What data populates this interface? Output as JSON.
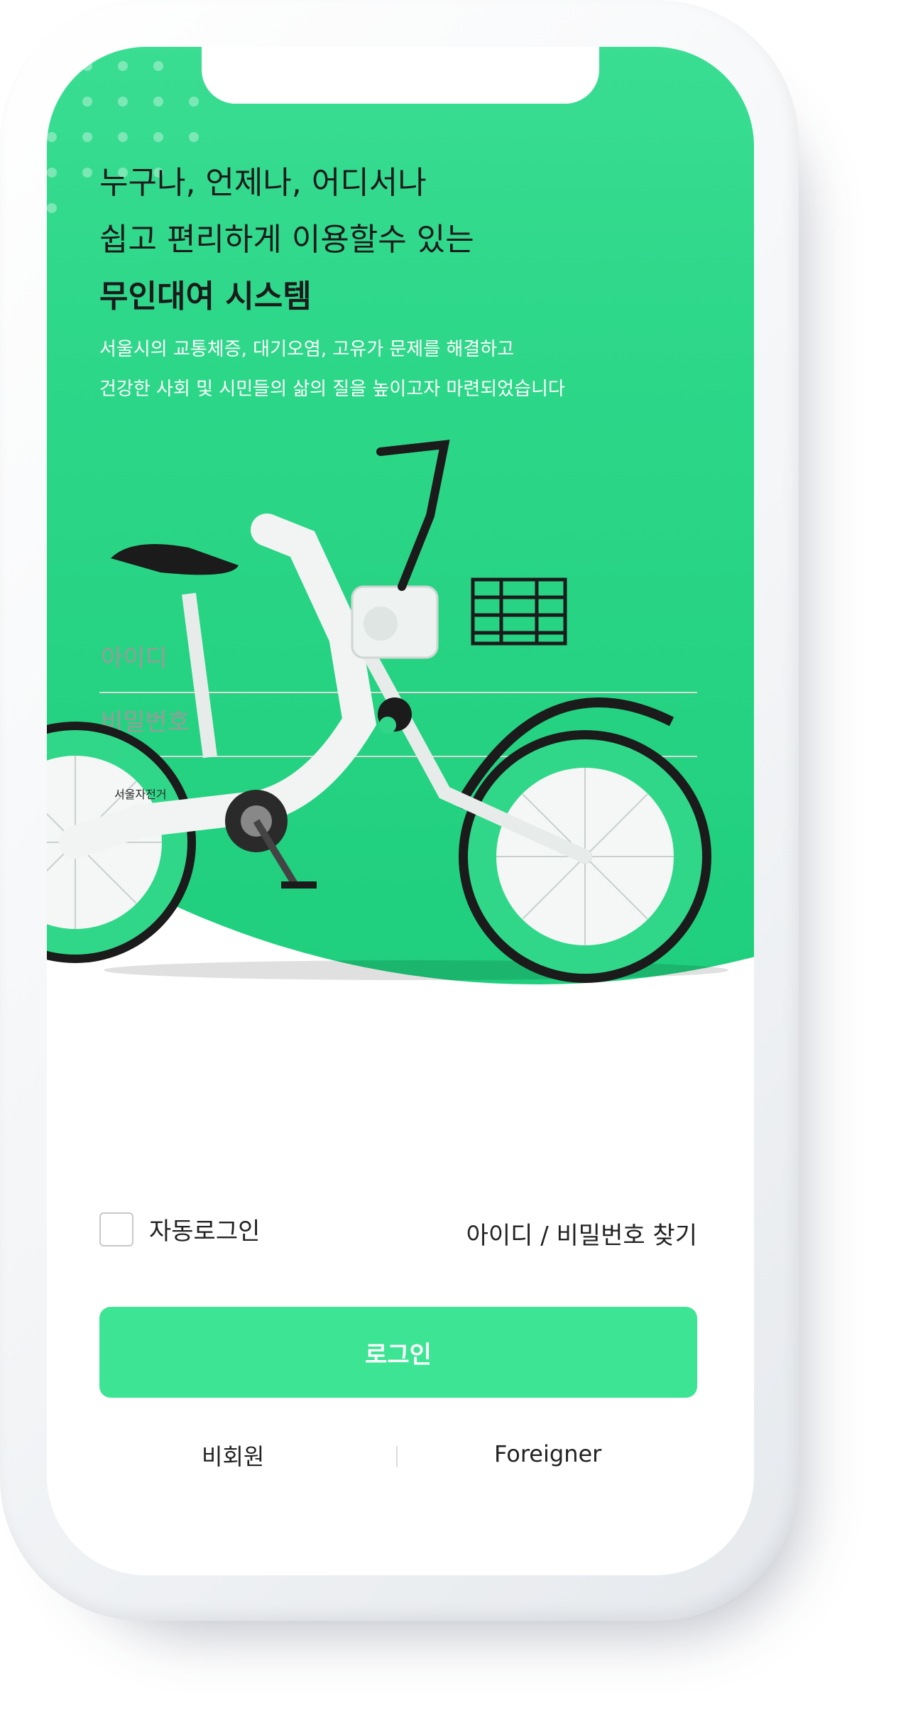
{
  "hero": {
    "line1": "누구나, 언제나, 어디서나",
    "line2": "쉽고 편리하게 이용할수 있는",
    "title_bold": "무인대여 시스템",
    "desc1": "서울시의 교통체증, 대기오염, 고유가 문제를 해결하고",
    "desc2": "건강한 사회 및 시민들의 삶의 질을 높이고자 마련되었습니다"
  },
  "bike": {
    "logo_text": "서울자전거"
  },
  "form": {
    "id_placeholder": "아이디",
    "password_placeholder": "비밀번호",
    "auto_login_label": "자동로그인",
    "auto_login_checked": false,
    "find_account_label": "아이디 / 비밀번호 찾기",
    "login_button": "로그인"
  },
  "footer": {
    "guest_label": "비회원",
    "foreigner_label": "Foreigner"
  },
  "colors": {
    "accent": "#3ce493",
    "hero_green": "#2fd88a"
  }
}
